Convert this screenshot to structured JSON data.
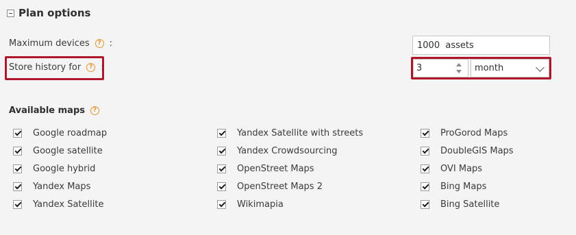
{
  "plan_options": {
    "title": "Plan options"
  },
  "maximum_devices": {
    "label": "Maximum devices",
    "colon": ":",
    "value": "1000  assets"
  },
  "store_history": {
    "label": "Store history for",
    "colon": ":",
    "amount": "3",
    "unit": "month"
  },
  "available_maps": {
    "title": "Available maps",
    "columns": [
      [
        {
          "label": "Google roadmap",
          "checked": true
        },
        {
          "label": "Google satellite",
          "checked": true
        },
        {
          "label": "Google hybrid",
          "checked": true
        },
        {
          "label": "Yandex Maps",
          "checked": true
        },
        {
          "label": "Yandex Satellite",
          "checked": true
        }
      ],
      [
        {
          "label": "Yandex Satellite with streets",
          "checked": true
        },
        {
          "label": "Yandex Crowdsourcing",
          "checked": true
        },
        {
          "label": "OpenStreet Maps",
          "checked": true
        },
        {
          "label": "OpenStreet Maps 2",
          "checked": true
        },
        {
          "label": "Wikimapia",
          "checked": true
        }
      ],
      [
        {
          "label": "ProGorod Maps",
          "checked": true
        },
        {
          "label": "DoubleGIS Maps",
          "checked": true
        },
        {
          "label": "OVI Maps",
          "checked": true
        },
        {
          "label": "Bing Maps",
          "checked": true
        },
        {
          "label": "Bing Satellite",
          "checked": true
        }
      ]
    ]
  },
  "colors": {
    "highlight": "#b0152e",
    "help_icon": "#e8932b",
    "background": "#f4f4f4"
  }
}
